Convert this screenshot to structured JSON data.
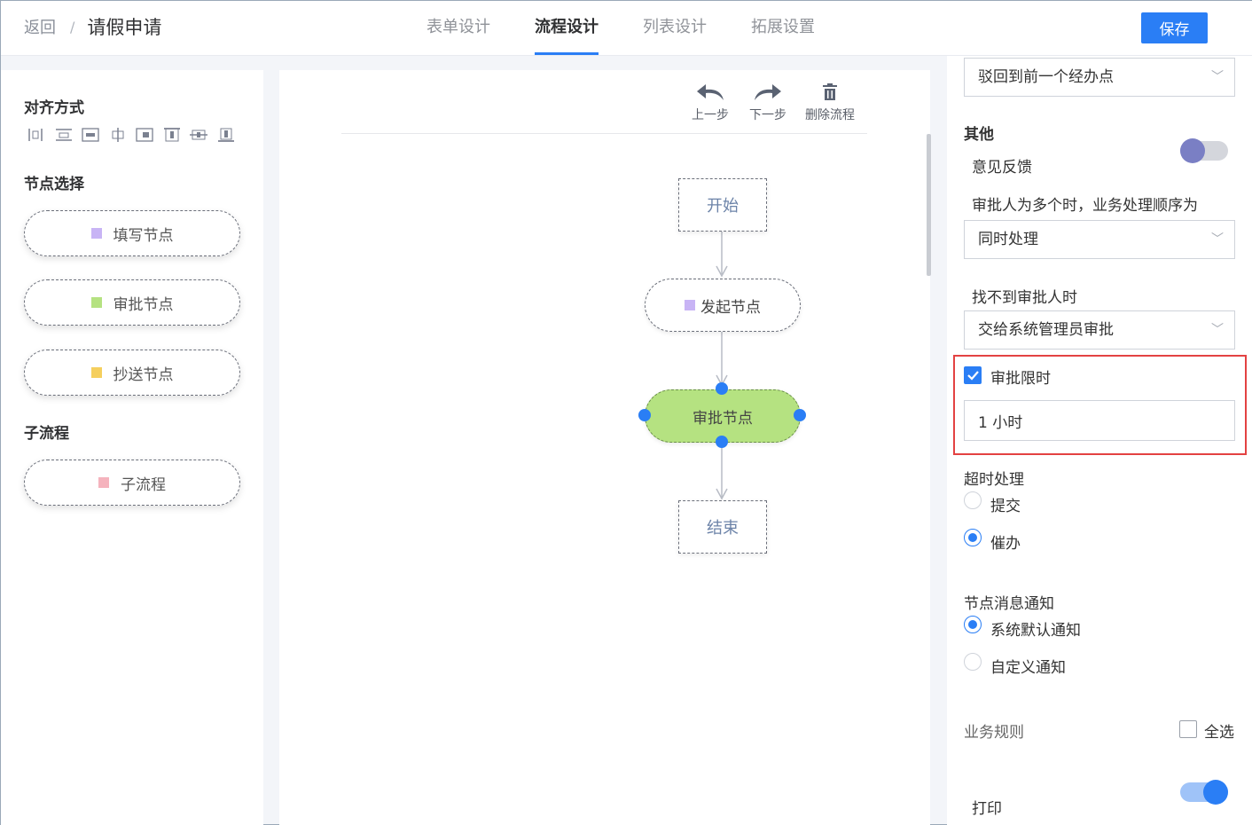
{
  "header": {
    "back_label": "返回",
    "separator": "/",
    "title": "请假申请",
    "tabs": [
      {
        "label": "表单设计",
        "active": false
      },
      {
        "label": "流程设计",
        "active": true
      },
      {
        "label": "列表设计",
        "active": false
      },
      {
        "label": "拓展设置",
        "active": false
      }
    ],
    "save_label": "保存"
  },
  "left_panel": {
    "align_title": "对齐方式",
    "align_icons": [
      "align-left-icon",
      "align-top-icon",
      "align-horizontal-icon",
      "align-center-icon",
      "align-right-icon",
      "align-bottom-edge-icon",
      "align-middle-icon",
      "align-vertical-icon"
    ],
    "node_title": "节点选择",
    "nodes": [
      {
        "label": "填写节点",
        "color": "#c8b4f5"
      },
      {
        "label": "审批节点",
        "color": "#b5e281"
      },
      {
        "label": "抄送节点",
        "color": "#f5cf5e"
      }
    ],
    "subflow_title": "子流程",
    "subflow": {
      "label": "子流程",
      "color": "#f5b3bd"
    }
  },
  "toolbar": {
    "undo_label": "上一步",
    "redo_label": "下一步",
    "delete_label": "删除流程"
  },
  "flow": {
    "start_label": "开始",
    "initiate_label": "发起节点",
    "initiate_color": "#c8b4f5",
    "approve_label": "审批节点",
    "end_label": "结束"
  },
  "right_panel": {
    "reject_select_value": "驳回到前一个经办点",
    "other_title": "其他",
    "feedback_label": "意见反馈",
    "feedback_on": false,
    "order_label": "审批人为多个时，业务处理顺序为",
    "order_value": "同时处理",
    "missing_label": "找不到审批人时",
    "missing_value": "交给系统管理员审批",
    "time_limit_label": "审批限时",
    "time_limit_checked": true,
    "time_limit_value": "1 小时",
    "timeout_title": "超时处理",
    "timeout_options": [
      {
        "label": "提交",
        "selected": false
      },
      {
        "label": "催办",
        "selected": true
      }
    ],
    "notify_title": "节点消息通知",
    "notify_options": [
      {
        "label": "系统默认通知",
        "selected": true
      },
      {
        "label": "自定义通知",
        "selected": false
      }
    ],
    "rules_label": "业务规则",
    "select_all_label": "全选",
    "print_label": "打印",
    "print_on": true
  },
  "colors": {
    "accent": "#2a7ef5",
    "highlight": "#e34242",
    "approve_fill": "#b5e281"
  }
}
